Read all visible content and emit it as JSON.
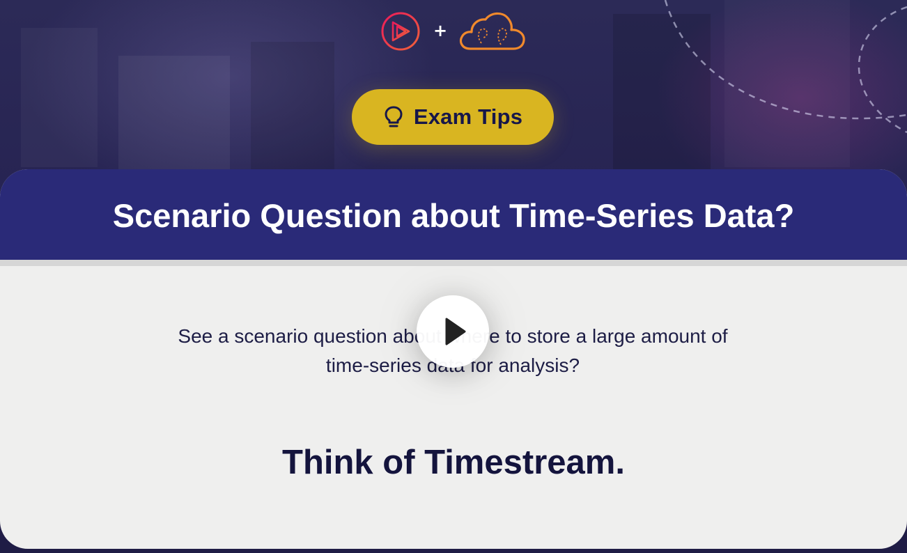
{
  "logos": {
    "left_icon": "pluralsight-play-icon",
    "separator": "+",
    "right_icon": "acloudguru-cloud-icon"
  },
  "exam_tips": {
    "icon": "lightbulb-icon",
    "label": "Exam Tips"
  },
  "card": {
    "title": "Scenario Question about Time-Series Data?",
    "description_lines": [
      "See a scenario question about where to store a large amount of",
      "time-series data for analysis?"
    ],
    "answer": "Think of Timestream."
  },
  "player": {
    "play_icon": "play-icon"
  },
  "colors": {
    "background": "#262352",
    "pill": "#d9b521",
    "header": "#2a2a78",
    "card": "#efefee",
    "text_dark": "#14143d",
    "logo_red": "#e6334e",
    "logo_orange": "#f0892c"
  }
}
